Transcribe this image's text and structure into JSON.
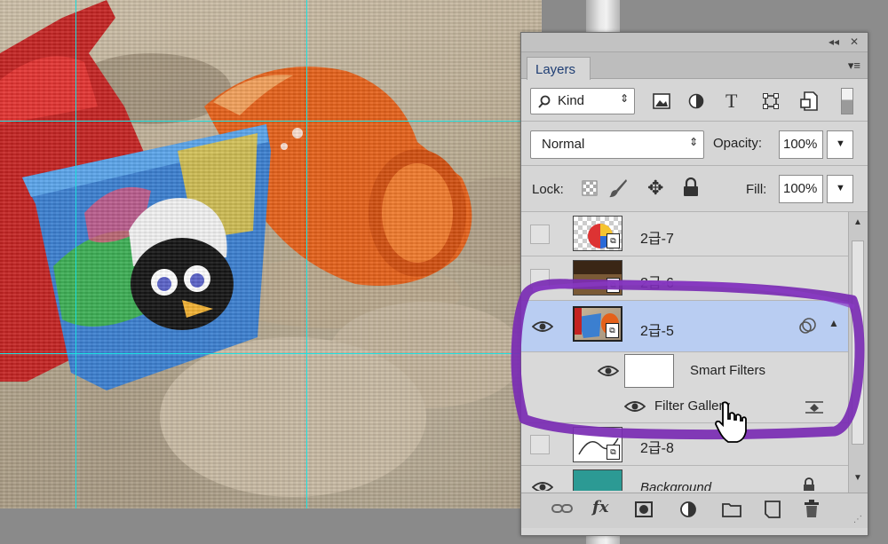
{
  "panel": {
    "collapse_glyph": "◂◂",
    "close_glyph": "✕",
    "tab_label": "Layers",
    "menu_glyph": "▾≡"
  },
  "filter_row": {
    "kind_label": "Kind",
    "icons": [
      "search-icon",
      "image-filter-icon",
      "adjustment-filter-icon",
      "type-filter-icon",
      "shape-filter-icon",
      "smart-object-filter-icon",
      "filter-toggle-switch"
    ]
  },
  "blend_row": {
    "mode": "Normal",
    "opacity_label": "Opacity:",
    "opacity_value": "100%"
  },
  "lock_row": {
    "lock_label": "Lock:",
    "fill_label": "Fill:",
    "fill_value": "100%"
  },
  "layers": [
    {
      "name": "2급-7",
      "visible": false
    },
    {
      "name": "2급-6",
      "visible": false
    },
    {
      "name": "2급-5",
      "visible": true,
      "selected": true
    },
    {
      "name": "Smart Filters",
      "visible": true,
      "sub": true
    },
    {
      "name": "Filter Gallery",
      "visible": true,
      "sub": true
    },
    {
      "name": "2급-8",
      "visible": false
    },
    {
      "name": "Background",
      "visible": true
    }
  ],
  "footer": {
    "icons": [
      "link-layers-icon",
      "fx-icon",
      "mask-icon",
      "adjustment-layer-icon",
      "group-folder-icon",
      "new-layer-icon",
      "trash-icon"
    ],
    "fx_label": "fx"
  },
  "colors": {
    "selected_row": "#b9cdf2",
    "guide": "#1ee3e3",
    "annotation": "#7a2bb3",
    "tab_text": "#1f3e74"
  }
}
